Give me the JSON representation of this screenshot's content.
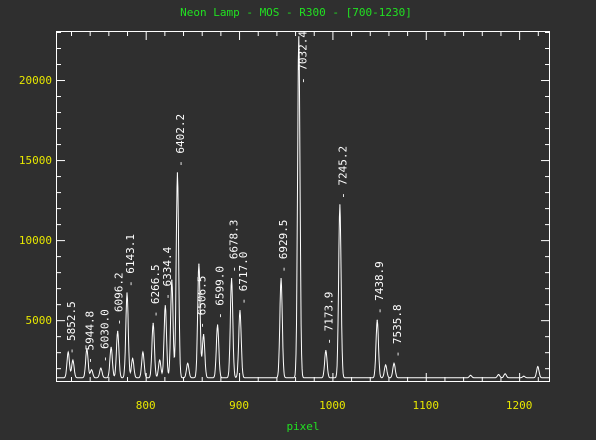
{
  "chart_data": {
    "type": "line",
    "title": "Neon Lamp - MOS - R300 - [700-1230]",
    "xlabel": "pixel",
    "ylabel": "",
    "xlim": [
      705,
      1232
    ],
    "ylim": [
      1200,
      23000
    ],
    "xticks": [
      800,
      900,
      1000,
      1100,
      1200
    ],
    "yticks": [
      5000,
      10000,
      15000,
      20000
    ],
    "grid": false,
    "colors": {
      "background": "#2f2f2f",
      "frame": "#ffffff",
      "line": "#ffffff",
      "title": "#22e022",
      "tick_labels": "#e8e800"
    },
    "baseline": 1400,
    "peaks": [
      {
        "x": 717,
        "y": 3000
      },
      {
        "x": 722,
        "y": 2500
      },
      {
        "x": 737,
        "y": 3200
      },
      {
        "x": 742,
        "y": 1900
      },
      {
        "x": 752,
        "y": 2000
      },
      {
        "x": 763,
        "y": 3300
      },
      {
        "x": 770,
        "y": 4300
      },
      {
        "x": 780,
        "y": 6700
      },
      {
        "x": 786,
        "y": 2600
      },
      {
        "x": 797,
        "y": 3000
      },
      {
        "x": 808,
        "y": 4800
      },
      {
        "x": 815,
        "y": 2500
      },
      {
        "x": 821,
        "y": 5900
      },
      {
        "x": 828,
        "y": 7500
      },
      {
        "x": 834,
        "y": 14200
      },
      {
        "x": 845,
        "y": 2300
      },
      {
        "x": 857,
        "y": 8500
      },
      {
        "x": 862,
        "y": 4100
      },
      {
        "x": 877,
        "y": 4700
      },
      {
        "x": 892,
        "y": 7600
      },
      {
        "x": 901,
        "y": 5600
      },
      {
        "x": 945,
        "y": 7600
      },
      {
        "x": 964,
        "y": 22700
      },
      {
        "x": 993,
        "y": 3100
      },
      {
        "x": 1008,
        "y": 12200
      },
      {
        "x": 1048,
        "y": 5000
      },
      {
        "x": 1057,
        "y": 2200
      },
      {
        "x": 1066,
        "y": 2300
      },
      {
        "x": 1148,
        "y": 1550
      },
      {
        "x": 1178,
        "y": 1600
      },
      {
        "x": 1185,
        "y": 1650
      },
      {
        "x": 1205,
        "y": 1500
      },
      {
        "x": 1220,
        "y": 2100
      }
    ],
    "annotations": [
      {
        "text": "- 5852.5",
        "x": 720
      },
      {
        "text": "- 5944.8",
        "x": 740
      },
      {
        "text": "- 6030.0",
        "x": 756
      },
      {
        "text": "- 6096.2",
        "x": 771
      },
      {
        "text": "- 6143.1",
        "x": 783
      },
      {
        "text": "- 6266.5",
        "x": 810
      },
      {
        "text": "- 6334.4",
        "x": 823
      },
      {
        "text": "- 6402.2",
        "x": 837
      },
      {
        "text": "- 6506.5",
        "x": 860
      },
      {
        "text": "- 6599.0",
        "x": 879
      },
      {
        "text": "- 6678.3",
        "x": 894
      },
      {
        "text": "- 6717.0",
        "x": 904
      },
      {
        "text": "- 6929.5",
        "x": 947
      },
      {
        "text": "- 7032.4",
        "x": 968
      },
      {
        "text": "- 7173.9",
        "x": 996
      },
      {
        "text": "- 7245.2",
        "x": 1011
      },
      {
        "text": "- 7438.9",
        "x": 1050
      },
      {
        "text": "- 7535.8",
        "x": 1069
      }
    ]
  }
}
